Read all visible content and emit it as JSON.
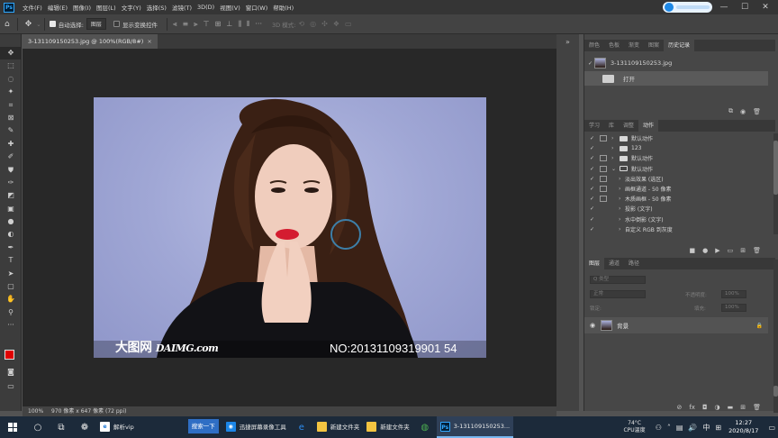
{
  "app": {
    "logo": "Ps",
    "menu": [
      "文件(F)",
      "编辑(E)",
      "图像(I)",
      "图层(L)",
      "文字(Y)",
      "选择(S)",
      "滤镜(T)",
      "3D(D)",
      "视图(V)",
      "窗口(W)",
      "帮助(H)"
    ],
    "window_controls": {
      "minimize": "—",
      "maximize": "☐",
      "close": "✕"
    }
  },
  "options_bar": {
    "auto_select_label": "自动选择:",
    "auto_select_value": "图层",
    "show_transform_label": "显示变换控件",
    "mode_3d_label": "3D 模式:"
  },
  "document": {
    "tab_title": "3-131109150253.jpg @ 100%(RGB/8#)",
    "close_glyph": "×",
    "zoom": "100%",
    "size_info": "970 像素 x 647 像素 (72 ppi)",
    "watermark_left_cn": "大图网",
    "watermark_left_latin": "DAIMG.com",
    "watermark_right": "NO:20131109319901 54"
  },
  "history_panel": {
    "tabs": [
      "颜色",
      "色板",
      "渐变",
      "图案",
      "历史记录"
    ],
    "active_tab": 4,
    "snapshot_name": "3-131109150253.jpg",
    "steps": [
      "打开"
    ]
  },
  "actions_panel": {
    "tabs": [
      "学习",
      "库",
      "调整",
      "动作"
    ],
    "active_tab": 3,
    "rows": [
      {
        "label": "默认动作",
        "type": "set",
        "expanded": false
      },
      {
        "label": "123",
        "type": "set",
        "expanded": false
      },
      {
        "label": "默认动作",
        "type": "set",
        "expanded": false
      },
      {
        "label": "默认动作",
        "type": "set",
        "expanded": true
      },
      {
        "label": "淡出效果 (选区)",
        "type": "action"
      },
      {
        "label": "画框通道 - 50 像素",
        "type": "action"
      },
      {
        "label": "木质画框 - 50 像素",
        "type": "action"
      },
      {
        "label": "投影 (文字)",
        "type": "action"
      },
      {
        "label": "水中倒影 (文字)",
        "type": "action"
      },
      {
        "label": "自定义 RGB 到灰度",
        "type": "action"
      }
    ]
  },
  "layers_panel": {
    "tabs": [
      "图层",
      "通道",
      "路径"
    ],
    "active_tab": 0,
    "filter_placeholder": "Q 类型",
    "blend_mode": "正常",
    "opacity_label": "不透明度:",
    "opacity_value": "100%",
    "lock_label": "锁定:",
    "fill_label": "填充:",
    "fill_value": "100%",
    "layer_name": "背景"
  },
  "taskbar": {
    "apps": [
      {
        "label": "解析vip",
        "icon": "e"
      },
      {
        "label": "迅捷屏幕录像工具",
        "icon": "◉"
      },
      {
        "label": "新建文件夹",
        "icon": ""
      },
      {
        "label": "新建文件夹",
        "icon": ""
      },
      {
        "label": "3-131109150253...",
        "icon": "Ps"
      }
    ],
    "search_button": "搜索一下",
    "temperature": "74°C",
    "temp_caption": "CPU温度",
    "ime": "中",
    "time": "12:27",
    "date": "2020/8/17"
  },
  "colors": {
    "foreground": "#e00000",
    "background": "#ffffff",
    "accent": "#31a8ff"
  }
}
